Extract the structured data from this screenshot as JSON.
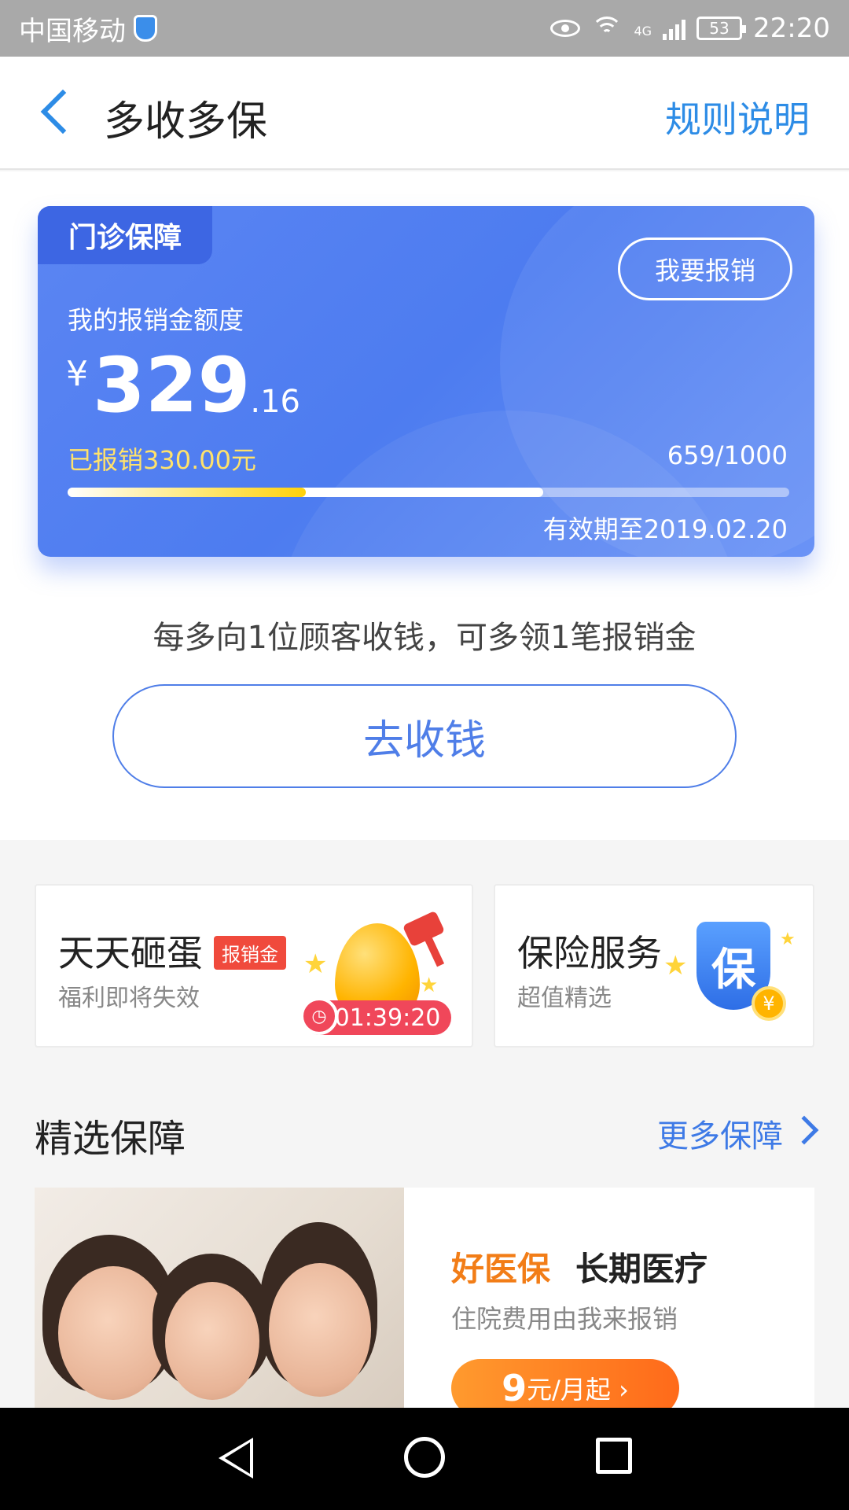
{
  "status_bar": {
    "carrier": "中国移动",
    "network": "4G",
    "battery": "53",
    "time": "22:20"
  },
  "nav": {
    "title": "多收多保",
    "rule_link": "规则说明"
  },
  "card": {
    "tag": "门诊保障",
    "claim_button": "我要报销",
    "label": "我的报销金额度",
    "currency": "¥",
    "amount_int": "329",
    "amount_dec": ".16",
    "reimbursed": "已报销330.00元",
    "count": "659/1000",
    "progress_count_fraction": 0.659,
    "progress_reimbursed_fraction": 0.33,
    "validity": "有效期至2019.02.20",
    "accent": "#4d7cf0"
  },
  "tip": "每多向1位顾客收钱，可多领1笔报销金",
  "collect_button": "去收钱",
  "tiles": {
    "egg": {
      "title": "天天砸蛋",
      "badge": "报销金",
      "subtitle": "福利即将失效",
      "timer": "01:39:20"
    },
    "insurance": {
      "title": "保险服务",
      "subtitle": "超值精选",
      "icon_char": "保",
      "coin": "¥"
    }
  },
  "featured": {
    "title": "精选保障",
    "more": "更多保障",
    "product": {
      "brand": "好医保",
      "name": "长期医疗",
      "desc": "住院费用由我来报销",
      "price_big": "9",
      "price_rest": "元/月起 ›"
    }
  }
}
